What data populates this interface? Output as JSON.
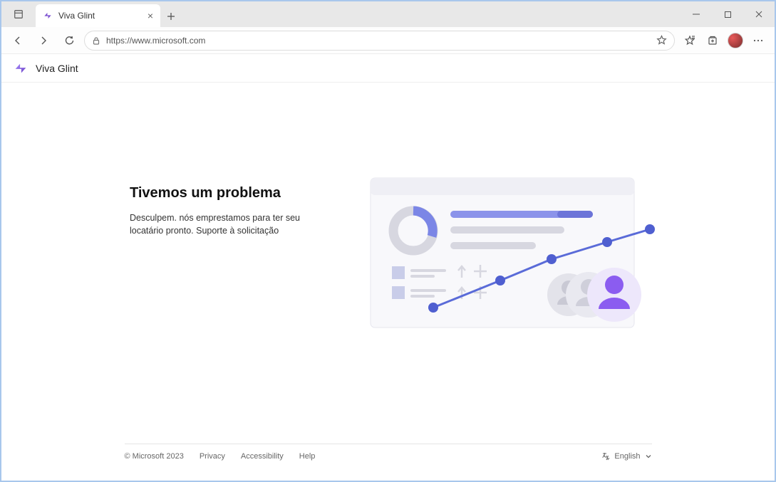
{
  "browser": {
    "tab_title": "Viva Glint",
    "url": "https://www.microsoft.com"
  },
  "header": {
    "product_name": "Viva Glint"
  },
  "error": {
    "title": "Tivemos um problema",
    "body": "Desculpem. nós emprestamos para ter seu locatário pronto. Suporte à solicitação"
  },
  "footer": {
    "copyright": "© Microsoft 2023",
    "links": {
      "privacy": "Privacy",
      "accessibility": "Accessibility",
      "help": "Help"
    },
    "language_label": "English"
  }
}
